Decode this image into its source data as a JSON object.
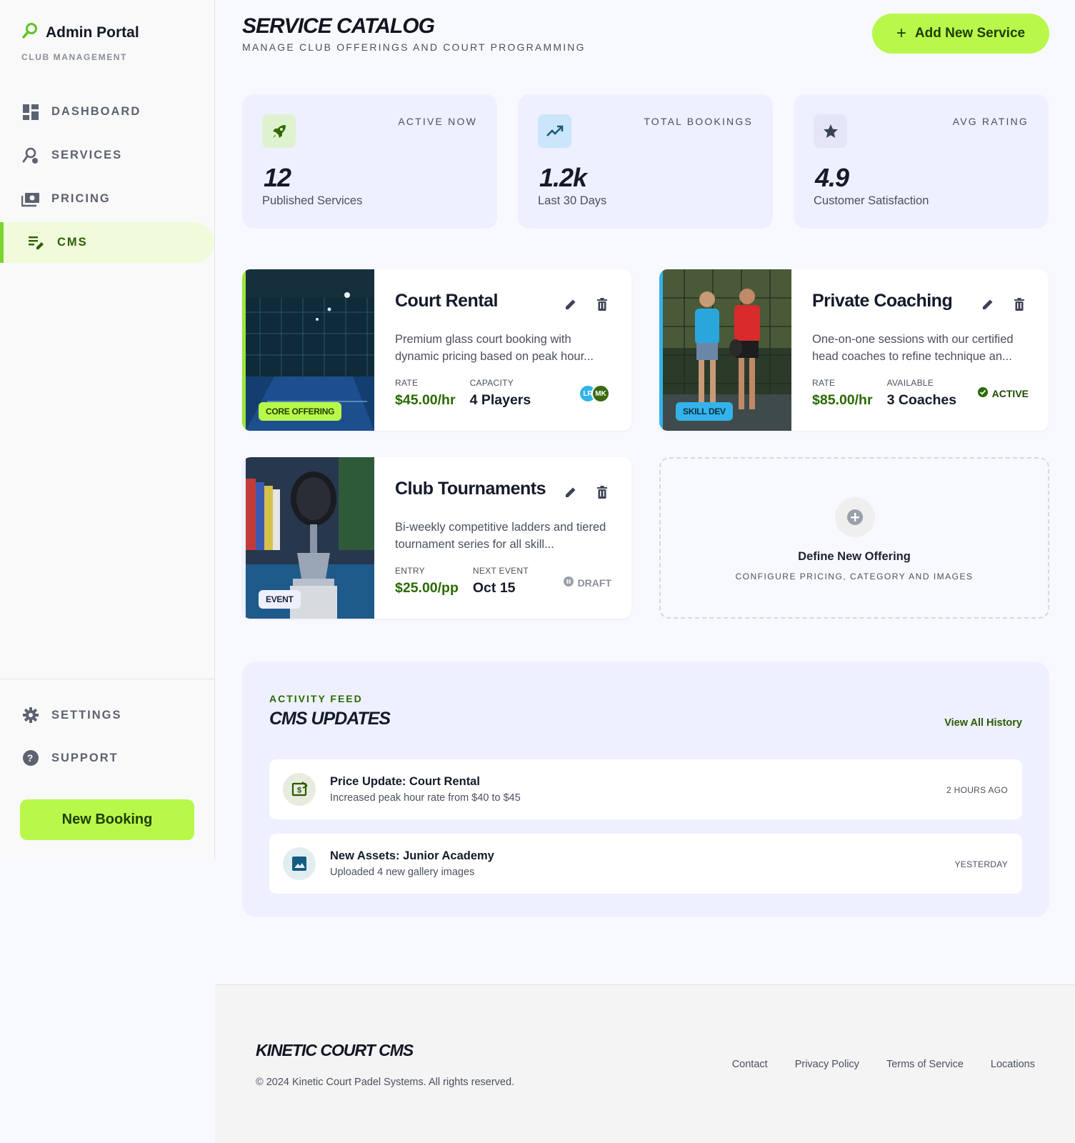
{
  "sidebar": {
    "brand_title": "Admin Portal",
    "brand_subtitle": "CLUB MANAGEMENT",
    "brand_icon": "search-person-icon",
    "nav": [
      {
        "label": "DASHBOARD",
        "icon": "dashboard-icon",
        "active": false
      },
      {
        "label": "SERVICES",
        "icon": "person-search-icon",
        "active": false
      },
      {
        "label": "PRICING",
        "icon": "payments-icon",
        "active": false
      },
      {
        "label": "CMS",
        "icon": "edit-note-icon",
        "active": true
      }
    ],
    "bottom_nav": [
      {
        "label": "SETTINGS",
        "icon": "gear-icon"
      },
      {
        "label": "SUPPORT",
        "icon": "help-icon"
      }
    ],
    "new_booking_label": "New Booking"
  },
  "header": {
    "title": "SERVICE CATALOG",
    "subtitle": "MANAGE CLUB OFFERINGS AND COURT PROGRAMMING",
    "add_button_label": "Add New Service"
  },
  "stats": [
    {
      "label": "ACTIVE NOW",
      "value": "12",
      "caption": "Published Services",
      "icon": "rocket-icon"
    },
    {
      "label": "TOTAL BOOKINGS",
      "value": "1.2k",
      "caption": "Last 30 Days",
      "icon": "trending-up-icon"
    },
    {
      "label": "AVG RATING",
      "value": "4.9",
      "caption": "Customer Satisfaction",
      "icon": "star-icon"
    }
  ],
  "services": [
    {
      "title": "Court Rental",
      "tag": "CORE OFFERING",
      "description": "Premium glass court booking with dynamic pricing based on peak hour...",
      "meta": [
        {
          "label": "RATE",
          "value": "$45.00/hr"
        },
        {
          "label": "CAPACITY",
          "value": "4 Players"
        }
      ],
      "avatars": [
        "LR",
        "MK"
      ]
    },
    {
      "title": "Private Coaching",
      "tag": "SKILL DEV",
      "description": "One-on-one sessions with our certified head coaches to refine technique an...",
      "meta": [
        {
          "label": "RATE",
          "value": "$85.00/hr"
        },
        {
          "label": "AVAILABLE",
          "value": "3 Coaches"
        }
      ],
      "status": "ACTIVE"
    },
    {
      "title": "Club Tournaments",
      "tag": "EVENT",
      "description": "Bi-weekly competitive ladders and tiered tournament series for all skill...",
      "meta": [
        {
          "label": "ENTRY",
          "value": "$25.00/pp"
        },
        {
          "label": "NEXT EVENT",
          "value": "Oct 15"
        }
      ],
      "status": "DRAFT"
    }
  ],
  "define_offering": {
    "title": "Define New Offering",
    "subtitle": "CONFIGURE PRICING, CATEGORY AND IMAGES"
  },
  "activity": {
    "kicker": "ACTIVITY FEED",
    "title": "CMS UPDATES",
    "view_all_label": "View All History",
    "items": [
      {
        "title": "Price Update: Court Rental",
        "subtitle": "Increased peak hour rate from $40 to $45",
        "time": "2 HOURS AGO",
        "icon": "price-change-icon"
      },
      {
        "title": "New Assets: Junior Academy",
        "subtitle": "Uploaded 4 new gallery images",
        "time": "YESTERDAY",
        "icon": "image-icon"
      }
    ]
  },
  "footer": {
    "brand": "KINETIC COURT CMS",
    "copyright": "© 2024 Kinetic Court Padel Systems. All rights reserved.",
    "links": [
      "Contact",
      "Privacy Policy",
      "Terms of Service",
      "Locations"
    ]
  },
  "colors": {
    "accent_lime": "#b8f84a",
    "accent_green": "#2a6a00",
    "accent_blue": "#33b3ea",
    "panel_lavender": "#eef0ff"
  }
}
